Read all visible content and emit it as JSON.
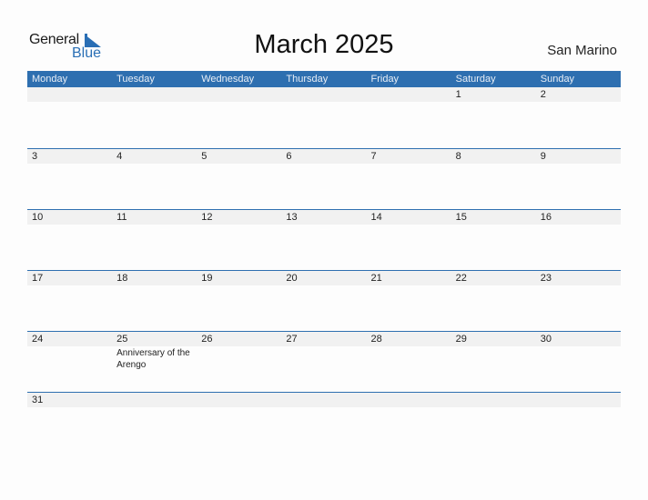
{
  "brand": {
    "line1": "General",
    "line2": "Blue",
    "accent": "#2a6fb5"
  },
  "title": "March 2025",
  "country": "San Marino",
  "header_color": "#2e6fb0",
  "weekdays": [
    "Monday",
    "Tuesday",
    "Wednesday",
    "Thursday",
    "Friday",
    "Saturday",
    "Sunday"
  ],
  "weeks": [
    [
      {
        "day": ""
      },
      {
        "day": ""
      },
      {
        "day": ""
      },
      {
        "day": ""
      },
      {
        "day": ""
      },
      {
        "day": "1"
      },
      {
        "day": "2"
      }
    ],
    [
      {
        "day": "3"
      },
      {
        "day": "4"
      },
      {
        "day": "5"
      },
      {
        "day": "6"
      },
      {
        "day": "7"
      },
      {
        "day": "8"
      },
      {
        "day": "9"
      }
    ],
    [
      {
        "day": "10"
      },
      {
        "day": "11"
      },
      {
        "day": "12"
      },
      {
        "day": "13"
      },
      {
        "day": "14"
      },
      {
        "day": "15"
      },
      {
        "day": "16"
      }
    ],
    [
      {
        "day": "17"
      },
      {
        "day": "18"
      },
      {
        "day": "19"
      },
      {
        "day": "20"
      },
      {
        "day": "21"
      },
      {
        "day": "22"
      },
      {
        "day": "23"
      }
    ],
    [
      {
        "day": "24"
      },
      {
        "day": "25",
        "event": "Anniversary of the Arengo"
      },
      {
        "day": "26"
      },
      {
        "day": "27"
      },
      {
        "day": "28"
      },
      {
        "day": "29"
      },
      {
        "day": "30"
      }
    ],
    [
      {
        "day": "31"
      },
      {
        "day": ""
      },
      {
        "day": ""
      },
      {
        "day": ""
      },
      {
        "day": ""
      },
      {
        "day": ""
      },
      {
        "day": ""
      }
    ]
  ]
}
